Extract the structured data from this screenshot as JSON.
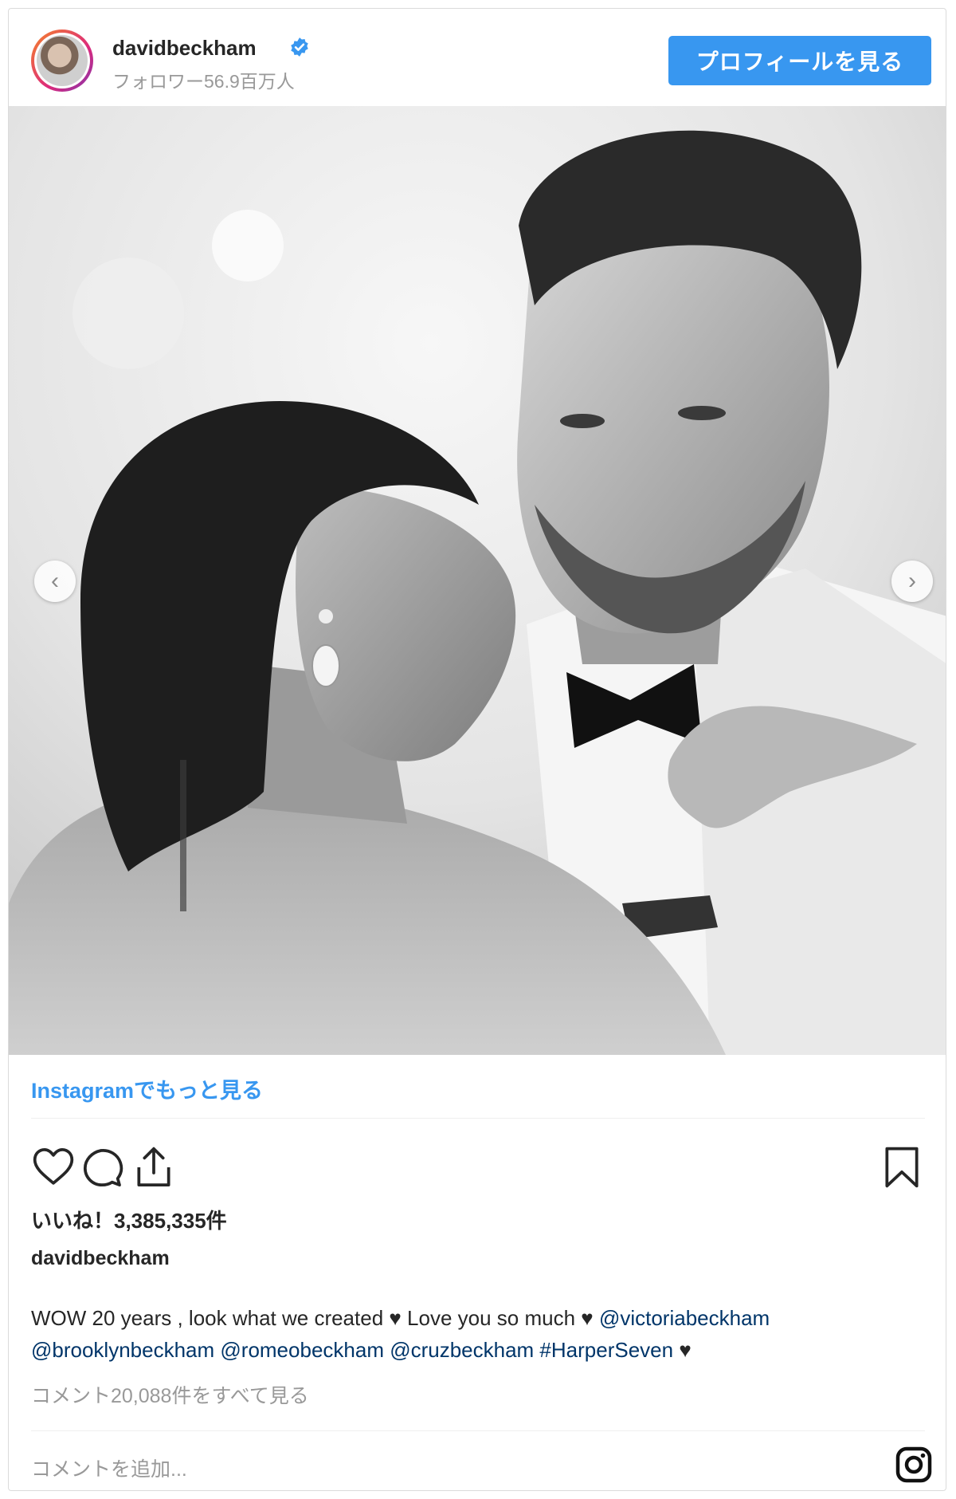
{
  "header": {
    "username": "davidbeckham",
    "followers": "フォロワー56.9百万人",
    "profile_button": "プロフィールを見る"
  },
  "post": {
    "more_on_instagram": "Instagramでもっと見る",
    "likes": "いいね！3,385,335件",
    "caption_user": "davidbeckham",
    "caption_line1_text": "WOW 20 years , look what we created ♥ Love you so much ♥ ",
    "caption_line1_mention": "@victoriabeckham",
    "caption_line2_mentions": "@brooklynbeckham @romeobeckham @cruzbeckham #HarperSeven",
    "caption_line2_tail": " ♥",
    "view_comments": "コメント20,088件をすべて見る",
    "add_comment_placeholder": "コメントを追加..."
  },
  "colors": {
    "accent": "#3897f0",
    "link": "#003569",
    "muted": "#999999"
  },
  "icons": [
    "heart-icon",
    "comment-icon",
    "share-icon",
    "bookmark-icon",
    "instagram-icon",
    "verified-icon",
    "chevron-left-icon",
    "chevron-right-icon"
  ]
}
